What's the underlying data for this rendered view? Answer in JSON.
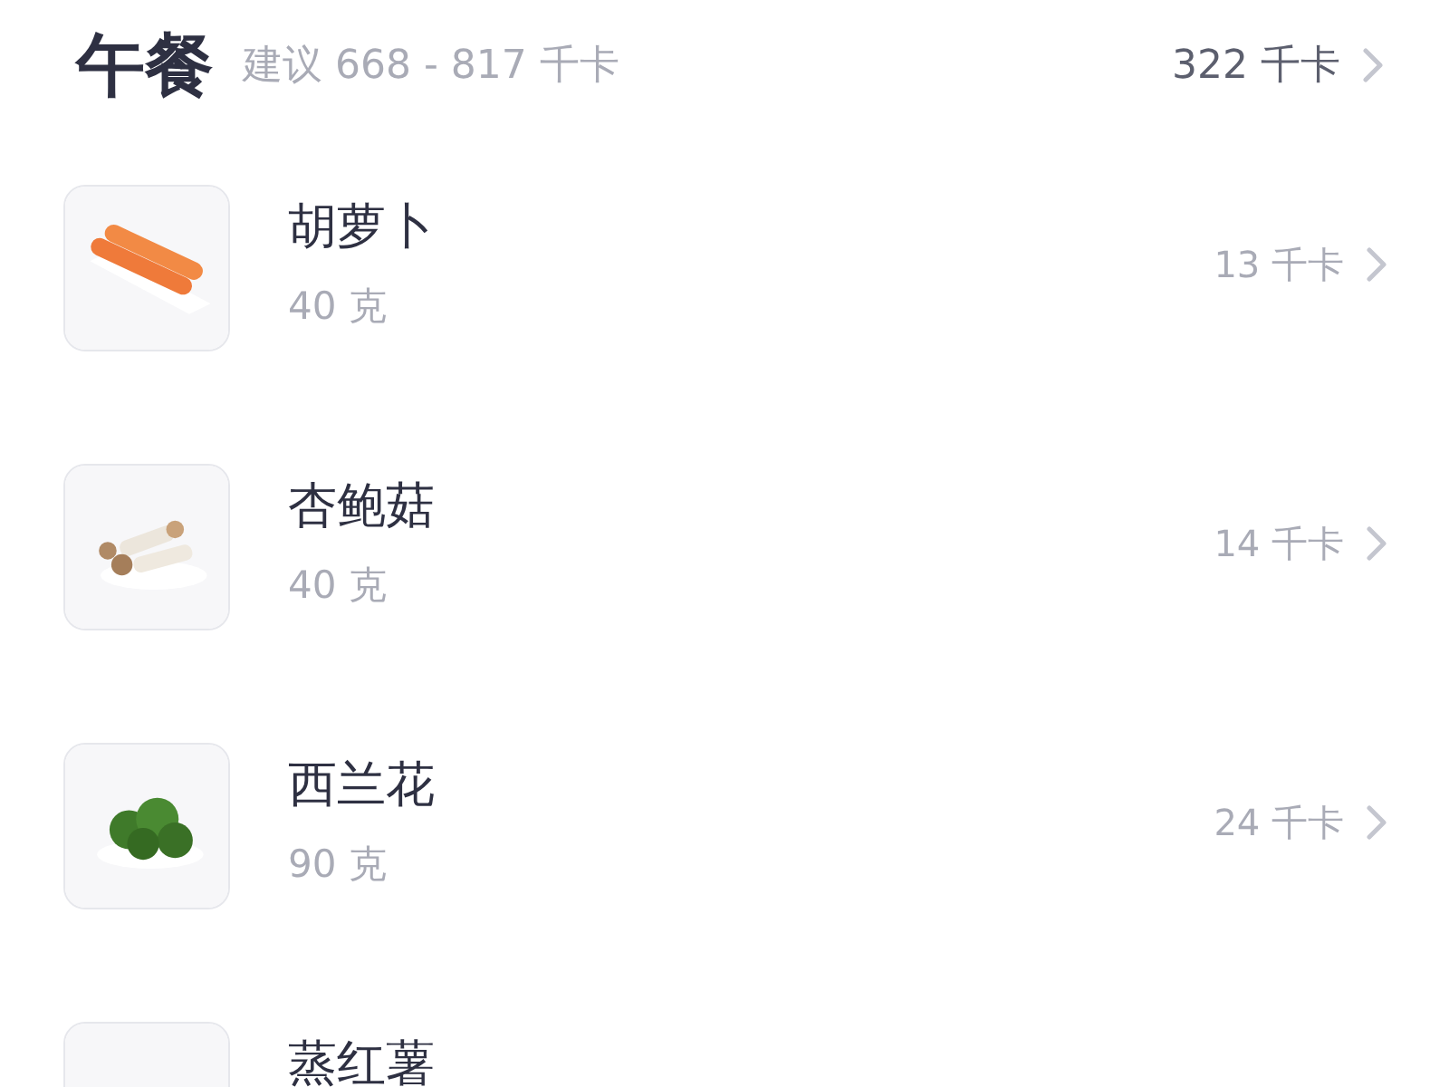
{
  "meal": {
    "title": "午餐",
    "suggestion": "建议 668 - 817 千卡",
    "total": "322 千卡"
  },
  "foods": [
    {
      "name": "胡萝卜",
      "amount": "40 克",
      "calories": "13 千卡"
    },
    {
      "name": "杏鲍菇",
      "amount": "40 克",
      "calories": "14 千卡"
    },
    {
      "name": "西兰花",
      "amount": "90 克",
      "calories": "24 千卡"
    },
    {
      "name": "蒸红薯"
    }
  ]
}
